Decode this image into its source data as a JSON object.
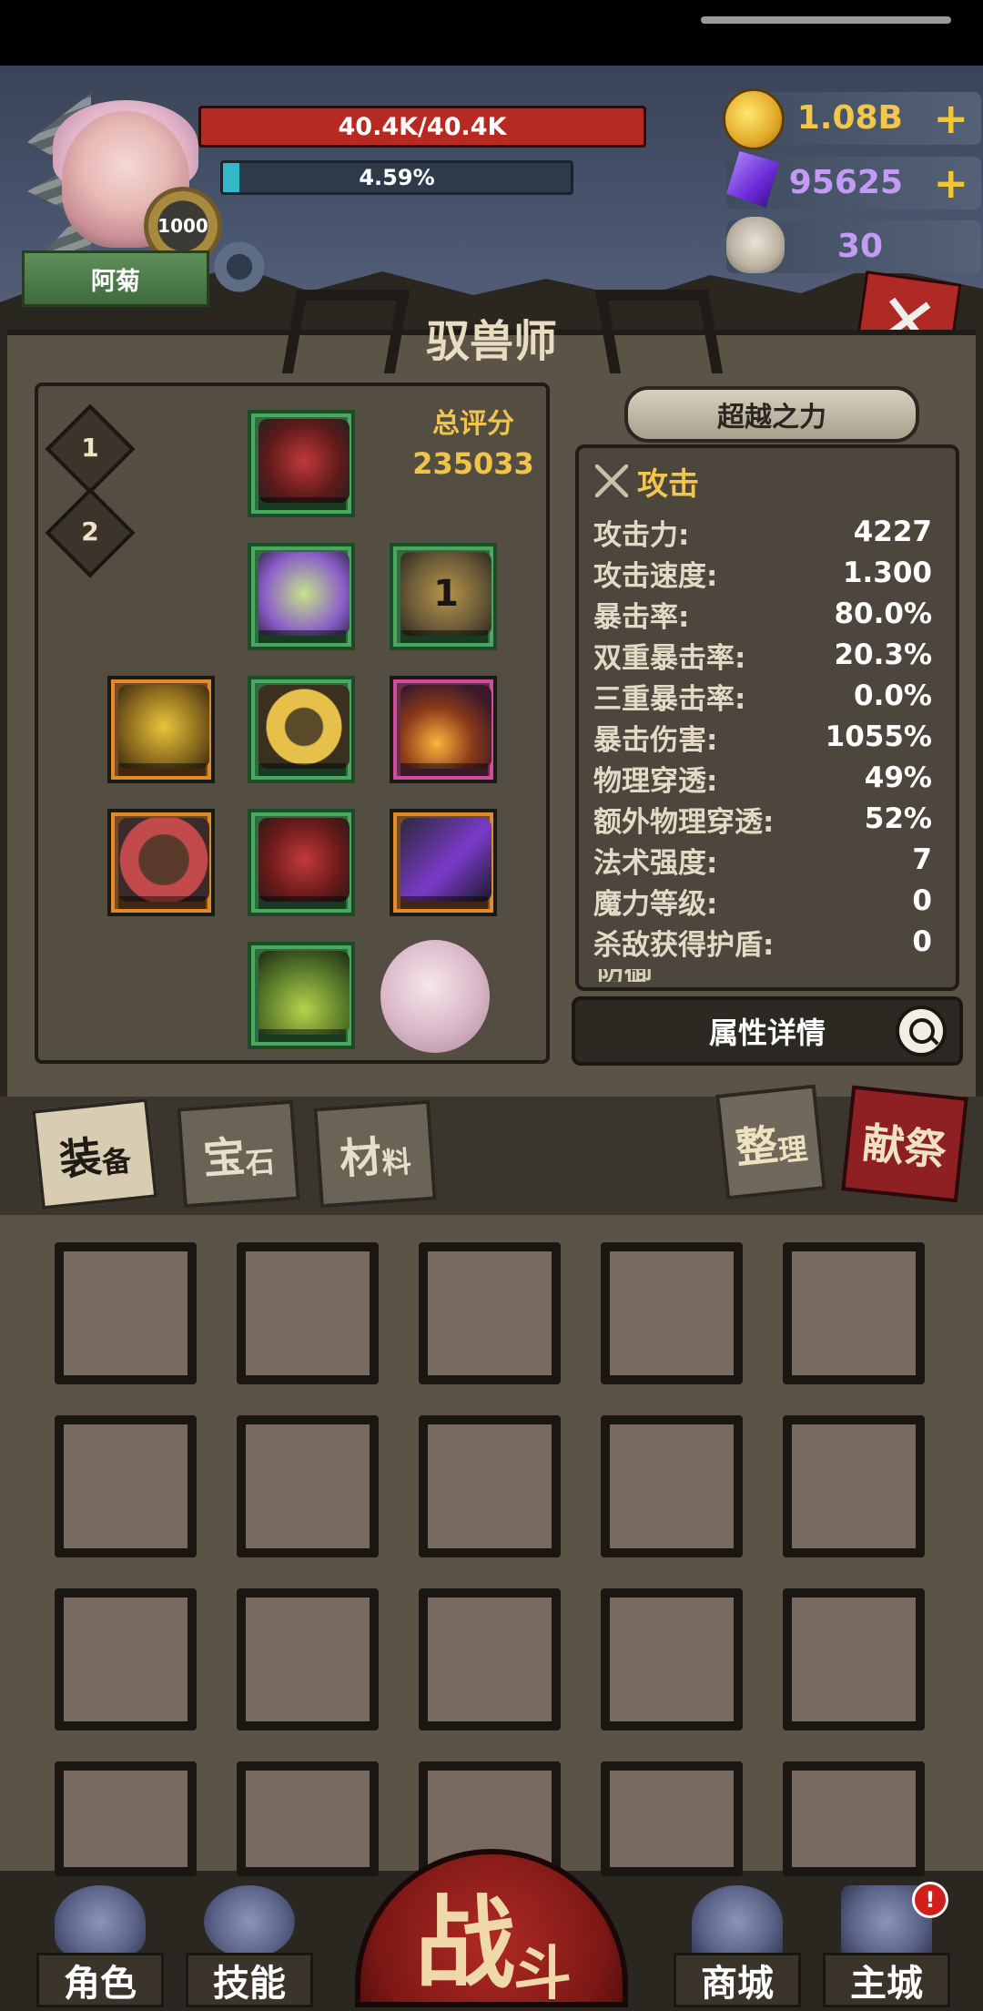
{
  "player": {
    "name": "阿菊",
    "level": "1000",
    "hp": "40.4K/40.4K",
    "exp_text": "4.59%",
    "exp_fraction": 0.0459
  },
  "currencies": [
    {
      "icon": "gold-coin-icon",
      "value": "1.08B",
      "plus": "+"
    },
    {
      "icon": "purple-gem-icon",
      "value": "95625",
      "plus": "+"
    },
    {
      "icon": "ram-skull-icon",
      "value": "30"
    }
  ],
  "page_title": "驭兽师",
  "loadout_tabs": [
    "1",
    "2"
  ],
  "score": {
    "label": "总评分",
    "value": "235033"
  },
  "beyond_button": "超越之力",
  "stats": {
    "section_title": "攻击",
    "rows": [
      {
        "label": "攻击力:",
        "value": "4227"
      },
      {
        "label": "攻击速度:",
        "value": "1.300"
      },
      {
        "label": "暴击率:",
        "value": "80.0%"
      },
      {
        "label": "双重暴击率:",
        "value": "20.3%"
      },
      {
        "label": "三重暴击率:",
        "value": "0.0%"
      },
      {
        "label": "暴击伤害:",
        "value": "1055%"
      },
      {
        "label": "物理穿透:",
        "value": "49%"
      },
      {
        "label": "额外物理穿透:",
        "value": "52%"
      },
      {
        "label": "法术强度:",
        "value": "7"
      },
      {
        "label": "魔力等级:",
        "value": "0"
      },
      {
        "label": "杀敌获得护盾:",
        "value": "0"
      }
    ],
    "next_section_partial": "防御"
  },
  "details_button": "属性详情",
  "equipment_slot_badge": "1",
  "inventory_tabs": [
    {
      "big": "装",
      "small": "备"
    },
    {
      "big": "宝",
      "small": "石"
    },
    {
      "big": "材",
      "small": "料"
    }
  ],
  "sort_button": {
    "big": "整",
    "small": "理"
  },
  "sacrifice_button": "献祭",
  "nav": {
    "role": "角色",
    "skills": "技能",
    "battle_big": "战",
    "battle_small": "斗",
    "shop": "商城",
    "main_city": "主城",
    "alert": "!"
  },
  "colors": {
    "accent_gold": "#f0c44a",
    "hp_red": "#b62a22",
    "panel_brown": "#5a5346",
    "slot_green": "#49a85c",
    "slot_orange": "#e08a2c",
    "slot_pink": "#d04c9e"
  }
}
